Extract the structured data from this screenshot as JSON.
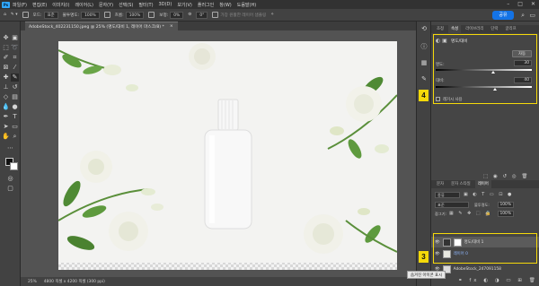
{
  "app": {
    "logo": "Ps"
  },
  "menu": [
    "파일(F)",
    "편집(E)",
    "이미지(I)",
    "레이어(L)",
    "문자(Y)",
    "선택(S)",
    "필터(T)",
    "3D(D)",
    "보기(V)",
    "플러그인",
    "창(W)",
    "도움말(H)"
  ],
  "options": {
    "mode_label": "모드:",
    "mode_value": "표준",
    "opacity_label": "불투명도:",
    "opacity_value": "100%",
    "flow_label": "흐름:",
    "flow_value": "100%",
    "smoothing_label": "보정:",
    "smoothing_value": "0%",
    "angle_value": "0°",
    "sample_all": "가장 원활한 레이어 샘플링"
  },
  "share_button": "공유",
  "document": {
    "tab": "AdobeStock_402231150.jpeg @ 25% (명도/대비 1, 레이어 마스크/8) *",
    "close": "×"
  },
  "status": {
    "zoom": "25%",
    "info": "4800 픽셀 x 4200 픽셀 (300 ppi)"
  },
  "panel": {
    "top_tabs": [
      "조정",
      "속성",
      "라이브러리",
      "단락",
      "글리프"
    ],
    "active_top_tab": "속성",
    "adjust_title": "명도/대비",
    "auto_button": "자동",
    "brightness_label": "명도:",
    "brightness_value": "30",
    "brightness_fraction": 0.6,
    "contrast_label": "대비:",
    "contrast_value": "40",
    "contrast_fraction": 0.62,
    "legacy_label": "레거시 사용",
    "layer_tabs": [
      "문자",
      "문자 스타일",
      "레이어"
    ],
    "active_layer_tab": "레이어",
    "filter_label": "종류",
    "blend_mode": "표준",
    "opacity_label": "불투명도:",
    "opacity_value": "100%",
    "lock_label": "잠그기:",
    "fill_label": "칠:",
    "fill_value": "100%",
    "layers": [
      {
        "name": "명도/대비 1",
        "type": "adjustment"
      },
      {
        "name": "레이어 0",
        "type": "image"
      },
      {
        "name": "AdobeStock_247091158",
        "type": "image"
      }
    ]
  },
  "annotations": {
    "badge_4": "4",
    "badge_3": "3"
  },
  "tooltip": "숨겨진 아이콘 표시",
  "colors": {
    "accent": "#1473e6",
    "highlight": "#f5d90a",
    "logo_bg": "#31a8ff"
  }
}
